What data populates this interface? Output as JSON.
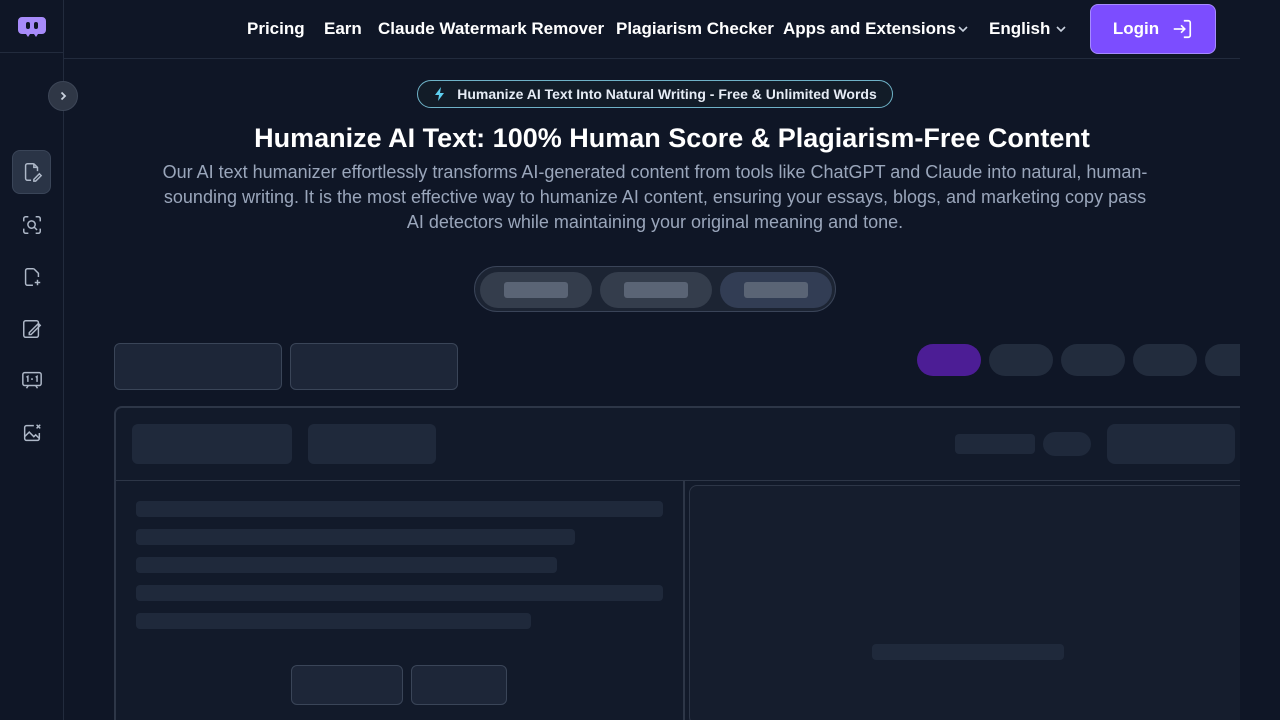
{
  "nav": {
    "pricing": "Pricing",
    "earn": "Earn",
    "watermark": "Claude Watermark Remover",
    "plagiarism": "Plagiarism Checker",
    "apps": "Apps and Extensions",
    "language": "English",
    "login": "Login"
  },
  "hero": {
    "badge": "Humanize AI Text Into Natural Writing - Free & Unlimited Words",
    "title": "Humanize AI Text: 100% Human Score & Plagiarism-Free Content",
    "description": "Our AI text humanizer effortlessly transforms AI-generated content from tools like ChatGPT and Claude into natural, human-sounding writing. It is the most effective way to humanize AI content, ensuring your essays, blogs, and marketing copy pass AI detectors while maintaining your original meaning and tone."
  },
  "sidebar": {
    "items": [
      {
        "icon": "humanizer-icon",
        "active": true
      },
      {
        "icon": "ai-detector-icon",
        "active": false
      },
      {
        "icon": "add-document-icon",
        "active": false
      },
      {
        "icon": "writer-icon",
        "active": false
      },
      {
        "icon": "compare-icon",
        "active": false
      },
      {
        "icon": "image-remove-icon",
        "active": false
      }
    ]
  },
  "colors": {
    "background": "#0f1626",
    "accent": "#7c4dff",
    "skeleton": "#1f293b",
    "active_chip": "#4c1d95"
  }
}
